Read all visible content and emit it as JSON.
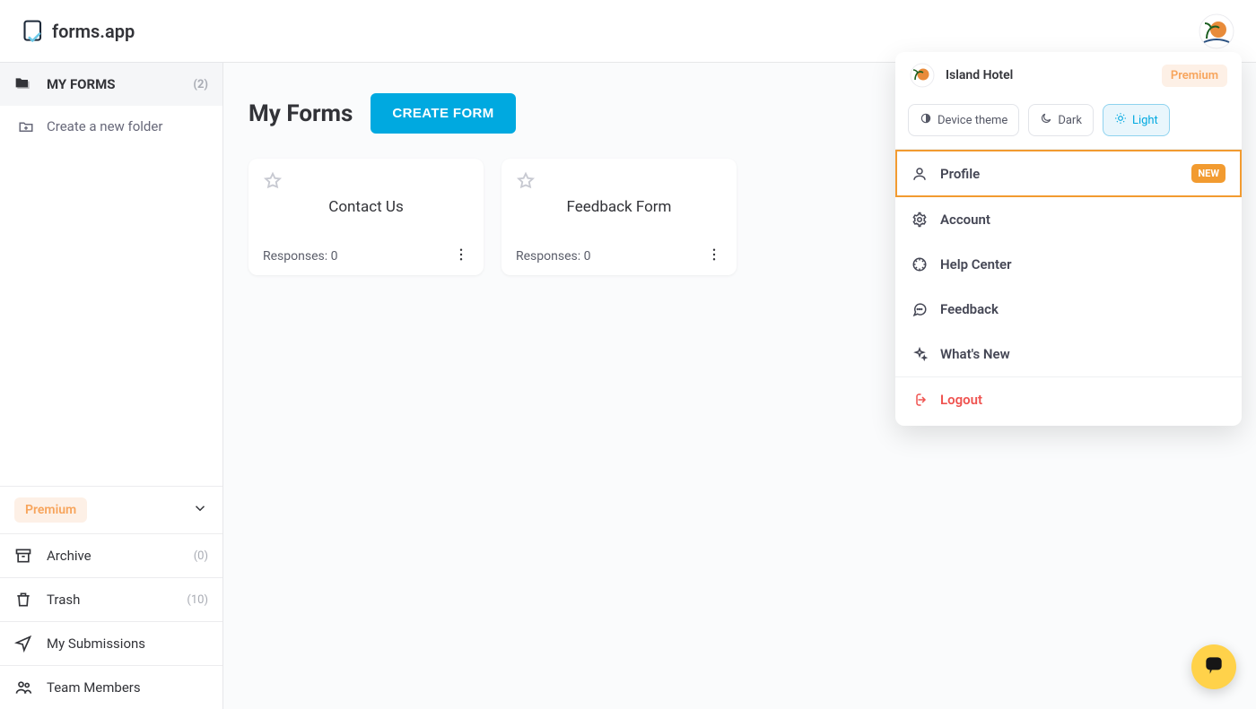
{
  "logo_text": "forms.app",
  "user": {
    "name": "Island Hotel",
    "plan_label": "Premium"
  },
  "sidebar": {
    "my_forms": {
      "label": "MY FORMS",
      "count_display": "(2)"
    },
    "create_folder_label": "Create a new folder",
    "premium_label": "Premium",
    "archive": {
      "label": "Archive",
      "count_display": "(0)"
    },
    "trash": {
      "label": "Trash",
      "count_display": "(10)"
    },
    "my_submissions_label": "My Submissions",
    "team_members_label": "Team Members"
  },
  "page": {
    "title": "My Forms",
    "create_button_label": "CREATE FORM",
    "cards": [
      {
        "title": "Contact Us",
        "responses_label": "Responses: 0"
      },
      {
        "title": "Feedback Form",
        "responses_label": "Responses: 0"
      }
    ]
  },
  "dropdown": {
    "theme": {
      "device_label": "Device theme",
      "dark_label": "Dark",
      "light_label": "Light"
    },
    "profile_label": "Profile",
    "profile_badge": "NEW",
    "account_label": "Account",
    "help_label": "Help Center",
    "feedback_label": "Feedback",
    "whatsnew_label": "What's New",
    "logout_label": "Logout"
  }
}
